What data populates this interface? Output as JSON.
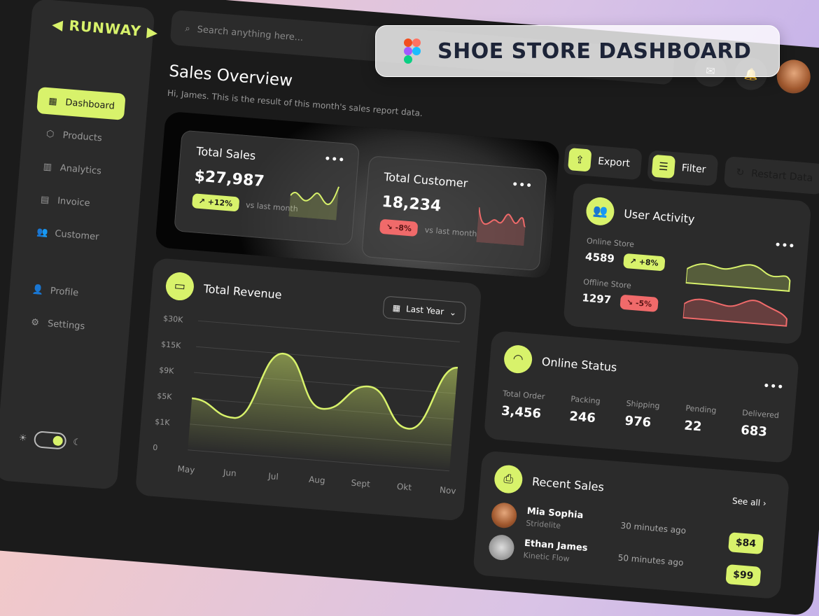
{
  "brand": "RUNWAY",
  "sidebar": {
    "items": [
      {
        "label": "Dashboard",
        "icon": "dashboard-icon",
        "active": true
      },
      {
        "label": "Products",
        "icon": "box-icon"
      },
      {
        "label": "Analytics",
        "icon": "chart-icon"
      },
      {
        "label": "Invoice",
        "icon": "invoice-icon"
      },
      {
        "label": "Customer",
        "icon": "users-icon"
      },
      {
        "label": "Profile",
        "icon": "user-icon"
      },
      {
        "label": "Settings",
        "icon": "gear-icon"
      }
    ],
    "theme_toggle": "dark"
  },
  "search": {
    "placeholder": "Search anything here..."
  },
  "header": {
    "title": "Sales Overview",
    "subtitle": "Hi, James. This is the result of this month's sales report data."
  },
  "actions": {
    "export": "Export",
    "filter": "Filter",
    "restart": "Restart Data"
  },
  "kpis": [
    {
      "title": "Total Sales",
      "value": "$27,987",
      "change": "+12%",
      "note": "vs last month",
      "trend": "up"
    },
    {
      "title": "Total Customer",
      "value": "18,234",
      "change": "-8%",
      "note": "vs last month",
      "trend": "down"
    }
  ],
  "user_activity": {
    "title": "User Activity",
    "online": {
      "label": "Online Store",
      "value": "4589",
      "change": "+8%"
    },
    "offline": {
      "label": "Offline Store",
      "value": "1297",
      "change": "-5%"
    }
  },
  "revenue": {
    "title": "Total Revenue",
    "period": "Last Year"
  },
  "chart_data": {
    "type": "area",
    "yticks": [
      "$30K",
      "$15K",
      "$9K",
      "$5K",
      "$1K",
      "0"
    ],
    "ytick_values": [
      30,
      15,
      9,
      5,
      1,
      0
    ],
    "categories": [
      "May",
      "Jun",
      "Jul",
      "Aug",
      "Sept",
      "Okt",
      "Nov"
    ],
    "values": [
      5,
      2.5,
      15,
      5,
      9,
      3,
      15
    ],
    "unit": "K$"
  },
  "online_status": {
    "title": "Online Status",
    "stats": [
      {
        "label": "Total Order",
        "value": "3,456"
      },
      {
        "label": "Packing",
        "value": "246"
      },
      {
        "label": "Shipping",
        "value": "976"
      },
      {
        "label": "Pending",
        "value": "22"
      },
      {
        "label": "Delivered",
        "value": "683"
      }
    ]
  },
  "recent_sales": {
    "title": "Recent Sales",
    "see_all": "See all",
    "rows": [
      {
        "name": "Mia Sophia",
        "product": "Stridelite",
        "time": "30 minutes ago",
        "price": "$84"
      },
      {
        "name": "Ethan James",
        "product": "Kinetic Flow",
        "time": "50 minutes ago",
        "price": "$99"
      }
    ]
  },
  "banner": {
    "title": "SHOE STORE DASHBOARD"
  },
  "colors": {
    "accent": "#d8f26b",
    "negative": "#f06a6a",
    "background": "#1b1b1b",
    "card": "#2b2b2b"
  }
}
